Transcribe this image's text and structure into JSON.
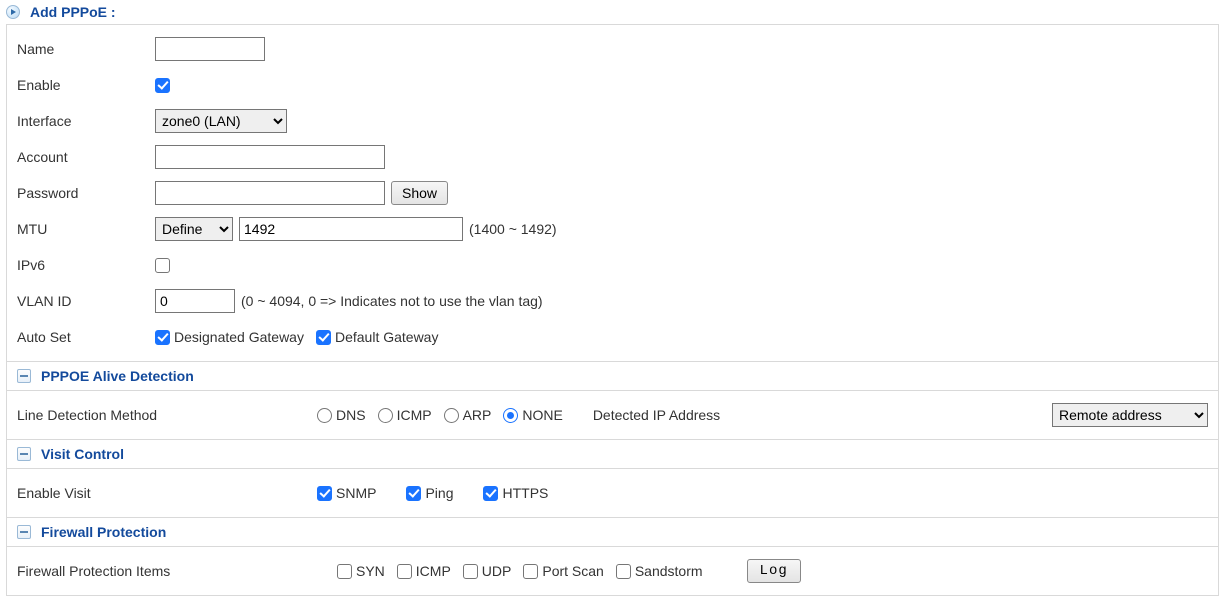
{
  "header": {
    "title": "Add PPPoE :"
  },
  "form": {
    "name": {
      "label": "Name",
      "value": ""
    },
    "enable": {
      "label": "Enable",
      "checked": true
    },
    "interface": {
      "label": "Interface",
      "selected": "zone0 (LAN)",
      "options": [
        "zone0 (LAN)"
      ]
    },
    "account": {
      "label": "Account",
      "value": ""
    },
    "password": {
      "label": "Password",
      "value": "",
      "show_btn": "Show"
    },
    "mtu": {
      "label": "MTU",
      "mode": "Define",
      "mode_options": [
        "Define"
      ],
      "value": "1492",
      "hint": "(1400 ~ 1492)"
    },
    "ipv6": {
      "label": "IPv6",
      "checked": false
    },
    "vlan": {
      "label": "VLAN ID",
      "value": "0",
      "hint": "(0 ~ 4094, 0 => Indicates not to use the vlan tag)"
    },
    "autoset": {
      "label": "Auto Set",
      "designated": {
        "label": "Designated Gateway",
        "checked": true
      },
      "default": {
        "label": "Default Gateway",
        "checked": true
      }
    }
  },
  "alive": {
    "title": "PPPOE Alive Detection",
    "method_label": "Line Detection Method",
    "methods": {
      "dns": {
        "label": "DNS",
        "checked": false
      },
      "icmp": {
        "label": "ICMP",
        "checked": false
      },
      "arp": {
        "label": "ARP",
        "checked": false
      },
      "none": {
        "label": "NONE",
        "checked": true
      }
    },
    "ip_label": "Detected IP Address",
    "ip_select": {
      "selected": "Remote address",
      "options": [
        "Remote address"
      ]
    }
  },
  "visit": {
    "title": "Visit Control",
    "enable_label": "Enable Visit",
    "snmp": {
      "label": "SNMP",
      "checked": true
    },
    "ping": {
      "label": "Ping",
      "checked": true
    },
    "https": {
      "label": "HTTPS",
      "checked": true
    }
  },
  "firewall": {
    "title": "Firewall Protection",
    "items_label": "Firewall Protection Items",
    "syn": {
      "label": "SYN",
      "checked": false
    },
    "icmp": {
      "label": "ICMP",
      "checked": false
    },
    "udp": {
      "label": "UDP",
      "checked": false
    },
    "portscan": {
      "label": "Port Scan",
      "checked": false
    },
    "sandstorm": {
      "label": "Sandstorm",
      "checked": false
    },
    "log_btn": "Log"
  }
}
